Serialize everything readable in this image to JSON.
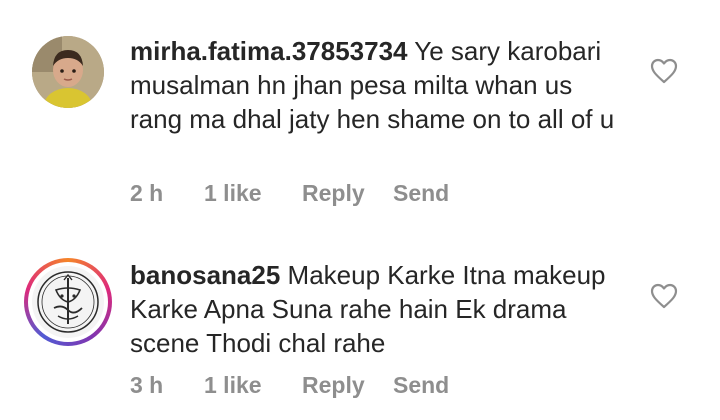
{
  "comments": [
    {
      "username": "mirha.fatima.37853734",
      "text": "Ye sary karobari musalman hn jhan pesa milta whan us rang ma dhal jaty hen  shame on to all of u",
      "time": "2 h",
      "likes": "1 like",
      "reply_label": "Reply",
      "send_label": "Send",
      "avatar_icon": "profile-photo",
      "like_icon": "heart-outline-icon"
    },
    {
      "username": "banosana25",
      "text": "Makeup Karke Itna makeup Karke Apna Suna rahe hain Ek drama scene Thodi chal rahe",
      "time": "3 h",
      "likes": "1 like",
      "reply_label": "Reply",
      "send_label": "Send",
      "avatar_icon": "calligraphy-logo-with-story-ring",
      "like_icon": "heart-outline-icon"
    }
  ],
  "colors": {
    "text": "#262626",
    "meta": "#8e8e8e",
    "story_ring": [
      "#f58529",
      "#dd2a7b",
      "#8134af",
      "#515bd4"
    ]
  }
}
